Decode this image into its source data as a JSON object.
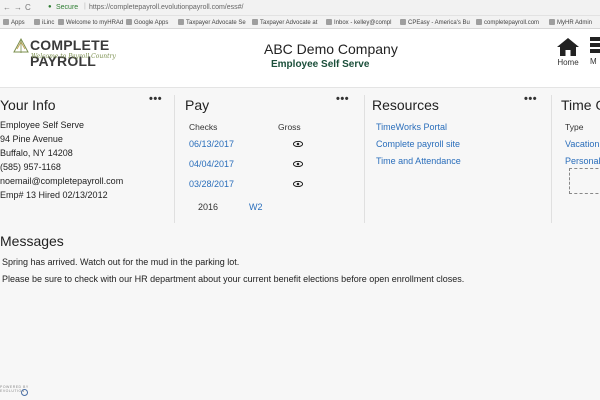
{
  "browser": {
    "secure_label": "Secure",
    "url": "https://completepayroll.evolutionpayroll.com/ess#/",
    "bookmarks": [
      "Apps",
      "iLinc",
      "Welcome to myHRAd",
      "Google Apps",
      "Taxpayer Advocate Se",
      "Taxpayer Advocate at",
      "Inbox - kelley@compl",
      "CPEasy - America's Bu",
      "completepayroll.com",
      "MyHR Admin"
    ]
  },
  "header": {
    "logo_name": "COMPLETE PAYROLL",
    "logo_tagline": "Welcome to Payroll Country",
    "company": "ABC Demo Company",
    "subtitle": "Employee Self Serve",
    "home_label": "Home",
    "more_label": "M"
  },
  "your_info": {
    "title": "Your Info",
    "more": "•••",
    "lines": [
      "Employee Self Serve",
      "94 Pine Avenue",
      "Buffalo, NY 14208",
      "(585) 957-1168",
      "noemail@completepayroll.com",
      "Emp# 13 Hired 02/13/2012"
    ]
  },
  "pay": {
    "title": "Pay",
    "more": "•••",
    "checks_header": "Checks",
    "gross_header": "Gross",
    "checks": [
      "06/13/2017",
      "04/04/2017",
      "03/28/2017"
    ],
    "w2_year": "2016",
    "w2_label": "W2"
  },
  "resources": {
    "title": "Resources",
    "more": "•••",
    "links": [
      "TimeWorks Portal",
      "Complete payroll site",
      "Time and Attendance"
    ]
  },
  "time_off": {
    "title": "Time O",
    "type_header": "Type",
    "items": [
      "Vacation",
      "Personal"
    ]
  },
  "messages": {
    "title": "Messages",
    "items": [
      "Spring has arrived. Watch out for the mud in the parking lot.",
      "Please be sure to check with our HR department about your current benefit elections before open enrollment closes."
    ]
  },
  "footer": {
    "powered_by": "POWERED BY",
    "brand": "EVOLUTION"
  },
  "colors": {
    "link": "#2a6ebb",
    "subtitle": "#1b4f3a",
    "background": "#f7f7f7"
  }
}
